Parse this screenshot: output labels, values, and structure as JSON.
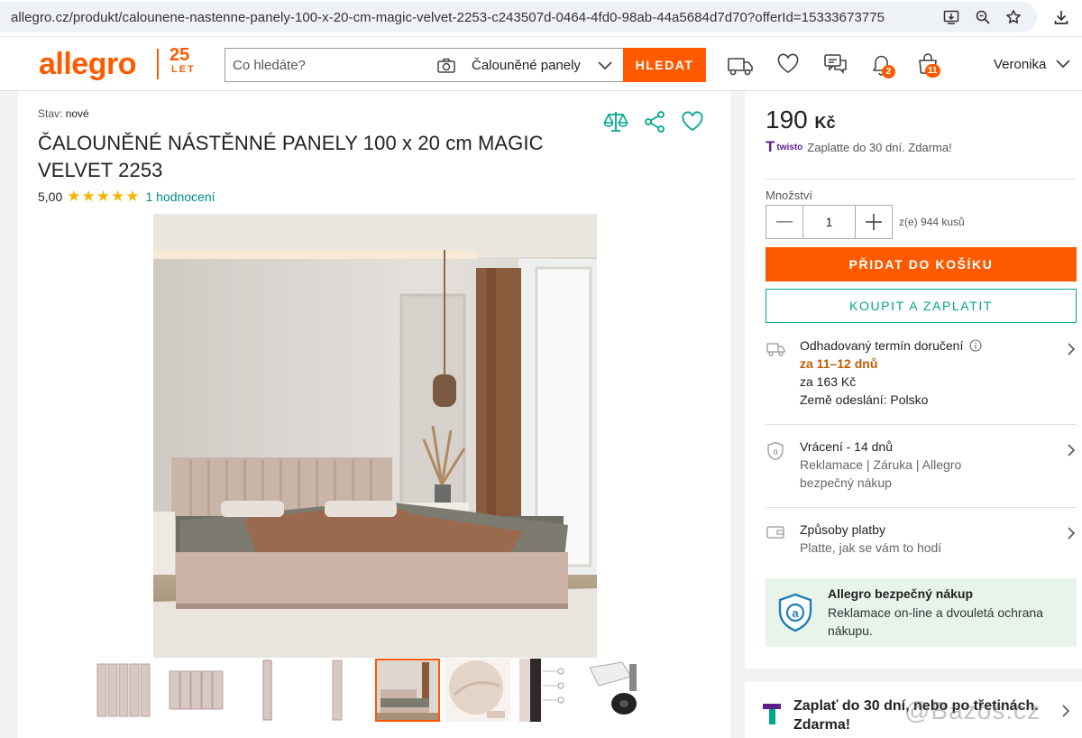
{
  "browser": {
    "url": "allegro.cz/produkt/calounene-nastenne-panely-100-x-20-cm-magic-velvet-2253-c243507d-0464-4fd0-98ab-44a5684d7d70?offerId=15333673775",
    "icons": [
      "install-icon",
      "zoom-icon",
      "star-icon",
      "download-icon"
    ]
  },
  "header": {
    "logo": "allegro",
    "logo_years": "25",
    "logo_let": "LET",
    "search_placeholder": "Co hledáte?",
    "category": "Čalouněné panely",
    "search_button": "HLEDAT",
    "notifications_count": "2",
    "cart_count": "11",
    "user_name": "Veronika"
  },
  "product": {
    "condition_label": "Stav:",
    "condition_value": "nové",
    "title": "ČALOUNĚNÉ NÁSTĚNNÉ PANELY 100 x 20 cm MAGIC VELVET 2253",
    "rating": "5,00",
    "stars": "★★★★★",
    "rating_count": "1 hodnocení",
    "thumbnail_count": 8,
    "active_thumbnail": 5
  },
  "purchase": {
    "price": "190",
    "currency": "Kč",
    "twisto_brand": "twisto",
    "twisto_text": "Zaplatte do 30 dní. Zdarma!",
    "quantity_label": "Množství",
    "quantity_value": "1",
    "availability": "z(e) 944 kusů",
    "add_to_cart": "PŘIDAT DO KOŠÍKU",
    "buy_now": "KOUPIT A ZAPLATIT",
    "delivery_title": "Odhadovaný termín doručení",
    "delivery_date": "za 11–12 dnů",
    "delivery_price": "za 163 Kč",
    "delivery_origin": "Země odeslání: Polsko",
    "returns_title": "Vrácení - 14 dnů",
    "returns_sub": "Reklamace | Záruka | Allegro bezpečný nákup",
    "payment_title": "Způsoby platby",
    "payment_sub": "Platte, jak se vám to hodí",
    "safe_title": "Allegro bezpečný nákup",
    "safe_text": "Reklamace on-line a dvouletá ochrana nákupu.",
    "promo_text": "Zaplať do 30 dní, nebo po třetinách. Zdarma!"
  },
  "watermark": "@Bazos.cz",
  "colors": {
    "accent": "#ff5a00",
    "teal": "#00a790",
    "safe_bg": "#e6f4ea"
  }
}
